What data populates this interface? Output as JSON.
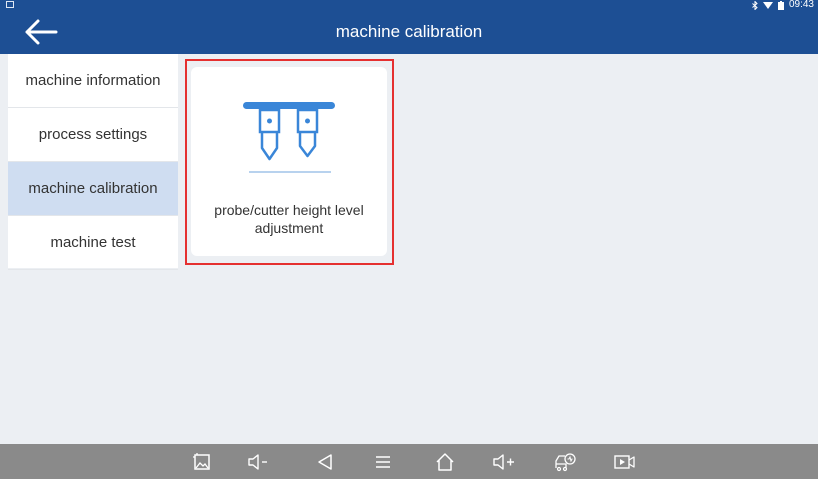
{
  "status": {
    "time": "09:43"
  },
  "header": {
    "title": "machine calibration"
  },
  "sidebar": {
    "items": [
      {
        "label": "machine information"
      },
      {
        "label": "process settings"
      },
      {
        "label": "machine calibration",
        "active": true
      },
      {
        "label": "machine test"
      }
    ]
  },
  "main": {
    "cards": [
      {
        "label": "probe/cutter height level adjustment",
        "icon": "probe-cutter-icon"
      }
    ]
  },
  "navbar": {
    "icons": [
      "screenshot-icon",
      "volume-down-icon",
      "back-triangle-icon",
      "menu-icon",
      "home-icon",
      "volume-up-icon",
      "vehicle-diagnostics-icon",
      "screen-record-icon"
    ]
  },
  "colors": {
    "header": "#1d4f94",
    "active_item": "#cfddf1",
    "highlight": "#e53030",
    "icon_blue": "#3a86d8",
    "navbar": "#8a8a8a",
    "background": "#eceff3"
  }
}
